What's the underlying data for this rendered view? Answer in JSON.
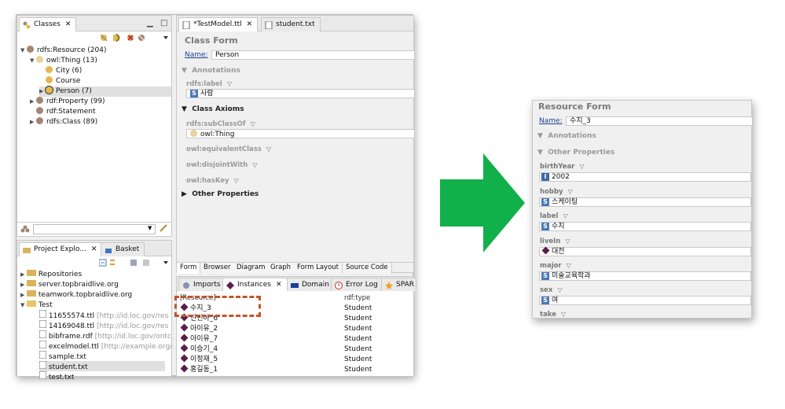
{
  "classes_view": {
    "tab_label": "Classes",
    "tree": [
      {
        "label": "rdfs:Resource",
        "count": "(204)",
        "icon": "class-ball-brown",
        "expanded": true
      },
      {
        "label": "owl:Thing",
        "count": "(13)",
        "icon": "class-ball-beige",
        "expanded": true
      },
      {
        "label": "City",
        "count": "(6)",
        "icon": "class-ball-gold"
      },
      {
        "label": "Course",
        "count": "",
        "icon": "class-ball-gold"
      },
      {
        "label": "Person",
        "count": "(7)",
        "icon": "class-ball-gold-selected",
        "selected": true
      },
      {
        "label": "rdf:Property",
        "count": "(99)",
        "icon": "class-ball-brown"
      },
      {
        "label": "rdf:Statement",
        "count": "",
        "icon": "class-ball-brown"
      },
      {
        "label": "rdfs:Class",
        "count": "(89)",
        "icon": "class-ball-brown"
      }
    ]
  },
  "project_explorer": {
    "tab_label": "Project Explo...",
    "basket_label": "Basket",
    "items": [
      {
        "label": "Repositories",
        "note": "",
        "kind": "folder"
      },
      {
        "label": "server.topbraidlive.org",
        "note": "",
        "kind": "folder"
      },
      {
        "label": "teamwork.topbraidlive.org",
        "note": "",
        "kind": "folder"
      },
      {
        "label": "Test",
        "note": "",
        "kind": "folder-open"
      },
      {
        "label": "11655574.ttl",
        "note": "[http://id.loc.gov/res",
        "kind": "file"
      },
      {
        "label": "14169048.ttl",
        "note": "[http://id.loc.gov/res",
        "kind": "file"
      },
      {
        "label": "bibframe.rdf",
        "note": "[http://id.loc.gov/ontc",
        "kind": "file"
      },
      {
        "label": "excelmodel.ttl",
        "note": "[http://example.org/",
        "kind": "file"
      },
      {
        "label": "sample.txt",
        "note": "",
        "kind": "file"
      },
      {
        "label": "student.txt",
        "note": "",
        "kind": "file",
        "selected": true
      },
      {
        "label": "test.txt",
        "note": "",
        "kind": "file"
      }
    ]
  },
  "editor": {
    "tabs": [
      "*TestModel.ttl",
      "student.txt"
    ],
    "form_title": "Class Form",
    "name_label": "Name:",
    "name_value": "Person",
    "annotations": "Annotations",
    "rdfs_label": "rdfs:label",
    "label_value": "사람",
    "class_axioms": "Class Axioms",
    "subclassof": "rdfs:subClassOf",
    "subclassof_value": "owl:Thing",
    "equivalent": "owl:equivalentClass",
    "disjoint": "owl:disjointWith",
    "haskey": "owl:hasKey",
    "other_props": "Other Properties",
    "bottom_tabs": [
      "Form",
      "Browser",
      "Diagram",
      "Graph",
      "Form Layout",
      "Source Code"
    ]
  },
  "instances_view": {
    "tabs": [
      "Imports",
      "Instances",
      "Domain",
      "Error Log",
      "SPAR"
    ],
    "col_resource": "[Resource]",
    "col_type": "rdf:type",
    "rows": [
      {
        "name": "수지_3",
        "type": "Student"
      },
      {
        "name": "진민아_6",
        "type": "Student"
      },
      {
        "name": "아이유_2",
        "type": "Student"
      },
      {
        "name": "아이유_7",
        "type": "Student"
      },
      {
        "name": "이승기_4",
        "type": "Student"
      },
      {
        "name": "이정재_5",
        "type": "Student"
      },
      {
        "name": "홍길동_1",
        "type": "Student"
      }
    ]
  },
  "resource_form": {
    "title": "Resource Form",
    "name_label": "Name:",
    "name_value": "수지_3",
    "annotations": "Annotations",
    "other_props": "Other Properties",
    "props": [
      {
        "label": "birthYear",
        "badge": "I",
        "value": "2002"
      },
      {
        "label": "hobby",
        "badge": "S",
        "value": "스케이팅"
      },
      {
        "label": "label",
        "badge": "S",
        "value": "수지"
      },
      {
        "label": "liveIn",
        "badge": "diamond",
        "value": "대전"
      },
      {
        "label": "major",
        "badge": "S",
        "value": "미술교육학과"
      },
      {
        "label": "sex",
        "badge": "S",
        "value": "여"
      },
      {
        "label": "take",
        "badge": "",
        "value": ""
      }
    ]
  },
  "colors": {
    "arrow": "#12b04a",
    "highlight_box": "#c0562a",
    "instance_diamond": "#5a1f4d"
  }
}
